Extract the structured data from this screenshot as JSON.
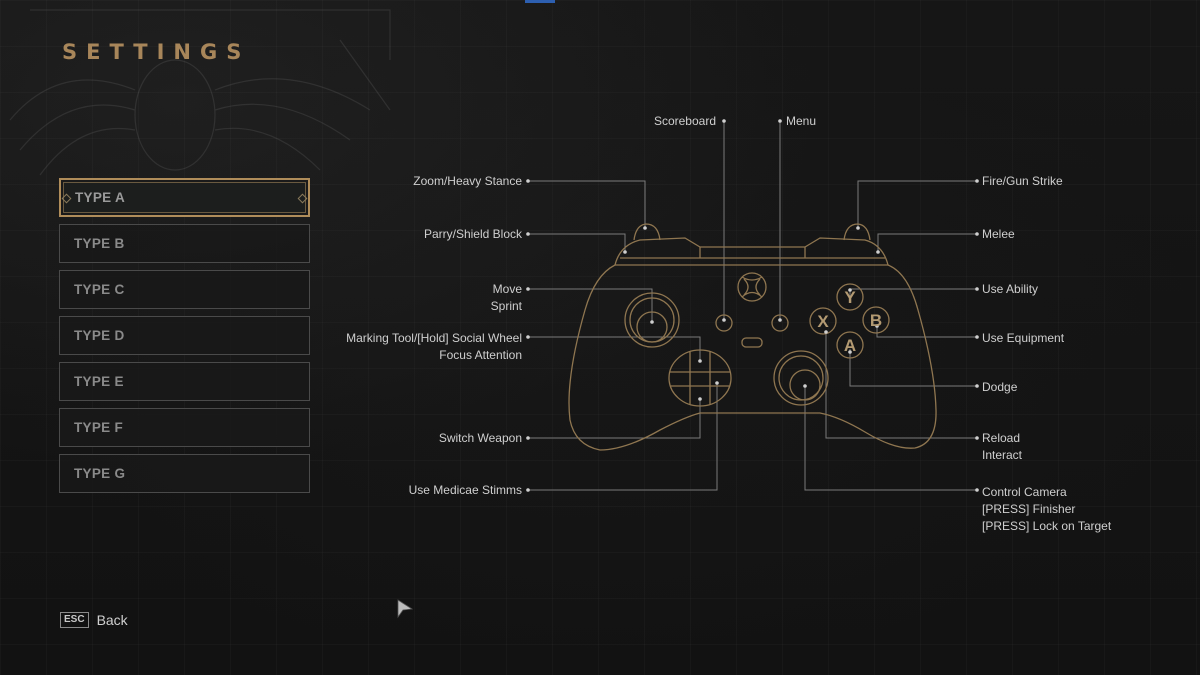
{
  "header": {
    "title": "SETTINGS"
  },
  "presets": [
    {
      "label": "TYPE A",
      "selected": true
    },
    {
      "label": "TYPE B",
      "selected": false
    },
    {
      "label": "TYPE C",
      "selected": false
    },
    {
      "label": "TYPE D",
      "selected": false
    },
    {
      "label": "TYPE E",
      "selected": false
    },
    {
      "label": "TYPE F",
      "selected": false
    },
    {
      "label": "TYPE G",
      "selected": false
    }
  ],
  "footer": {
    "back_key": "ESC",
    "back_label": "Back"
  },
  "controller": {
    "face_buttons": {
      "y": "Y",
      "x": "X",
      "b": "B",
      "a": "A"
    },
    "bindings_left": {
      "lt": [
        "Zoom/Heavy Stance"
      ],
      "lb": [
        "Parry/Shield Block"
      ],
      "ls": [
        "Move",
        "Sprint"
      ],
      "dpad_up": [
        "Marking Tool/[Hold] Social Wheel",
        "Focus Attention"
      ],
      "dpad_down": [
        "Switch Weapon"
      ],
      "dpad_right": [
        "Use Medicae Stimms"
      ]
    },
    "bindings_top": {
      "view": [
        "Scoreboard"
      ],
      "menu": [
        "Menu"
      ]
    },
    "bindings_right": {
      "rt": [
        "Fire/Gun Strike"
      ],
      "rb": [
        "Melee"
      ],
      "y": [
        "Use Ability"
      ],
      "b": [
        "Use Equipment"
      ],
      "a": [
        "Dodge"
      ],
      "x": [
        "Reload",
        "Interact"
      ],
      "rs": [
        "Control Camera",
        "[PRESS] Finisher",
        "[PRESS] Lock on Target"
      ]
    }
  },
  "colors": {
    "accent_gold": "#b08d5a",
    "title_gold": "#a8865a",
    "controller_line": "#8f7650"
  }
}
